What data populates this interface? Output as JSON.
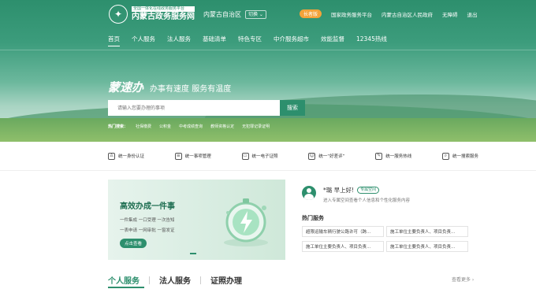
{
  "header": {
    "logo_sub": "全国一体化在线政务服务平台",
    "logo_main": "内蒙古政务服务网",
    "region": "内蒙古自治区",
    "switch_label": "切换",
    "care_badge": "长者版",
    "top_links": [
      "国家政务服务平台",
      "内蒙古自治区人民政府",
      "无障碍",
      "退出"
    ]
  },
  "nav": {
    "items": [
      "首页",
      "个人服务",
      "法人服务",
      "基础清单",
      "特色专区",
      "中介服务超市",
      "效能监督",
      "12345热线"
    ]
  },
  "hero": {
    "brand": "蒙速办",
    "slogan": "办事有速度 服务有温度",
    "search_placeholder": "请输入您要办理的事项",
    "search_button": "搜索",
    "hot_label": "热门搜索：",
    "hot_items": [
      "社保缴费",
      "公积金",
      "中考成绩查询",
      "教师资格认定",
      "无犯罪记录证明"
    ]
  },
  "quick_services": [
    {
      "icon": "person-verify-icon",
      "label": "统一身份认证"
    },
    {
      "icon": "matter-manage-icon",
      "label": "统一事项管理"
    },
    {
      "icon": "e-license-icon",
      "label": "统一电子证照"
    },
    {
      "icon": "review-icon",
      "label": "统一“好差评”"
    },
    {
      "icon": "hotline-icon",
      "label": "统一服务热线"
    },
    {
      "icon": "search-service-icon",
      "label": "统一搜索服务"
    }
  ],
  "banner": {
    "title": "高效办成一件事",
    "line1": "一件集成   一口受理   一次告知",
    "line2": "一表申请   一网审批   一窗发证",
    "button": "点击查看"
  },
  "user_panel": {
    "name": "*璐 早上好!",
    "tag": "专属空间",
    "desc": "进入专属空间查看个人信息和个性化服务内容",
    "hot_title": "热门服务",
    "hot_services": [
      "超限运输车辆行驶公路许可（跨...",
      "施工单位主要负责人、项目负责...",
      "施工单位主要负责人、项目负责...",
      "施工单位主要负责人、项目负责..."
    ]
  },
  "section_tabs": {
    "items": [
      "个人服务",
      "法人服务",
      "证照办理"
    ],
    "view_more": "查看更多 ›"
  },
  "colors": {
    "brand_green": "#2d8f6d",
    "care_orange": "#f3a33a"
  }
}
